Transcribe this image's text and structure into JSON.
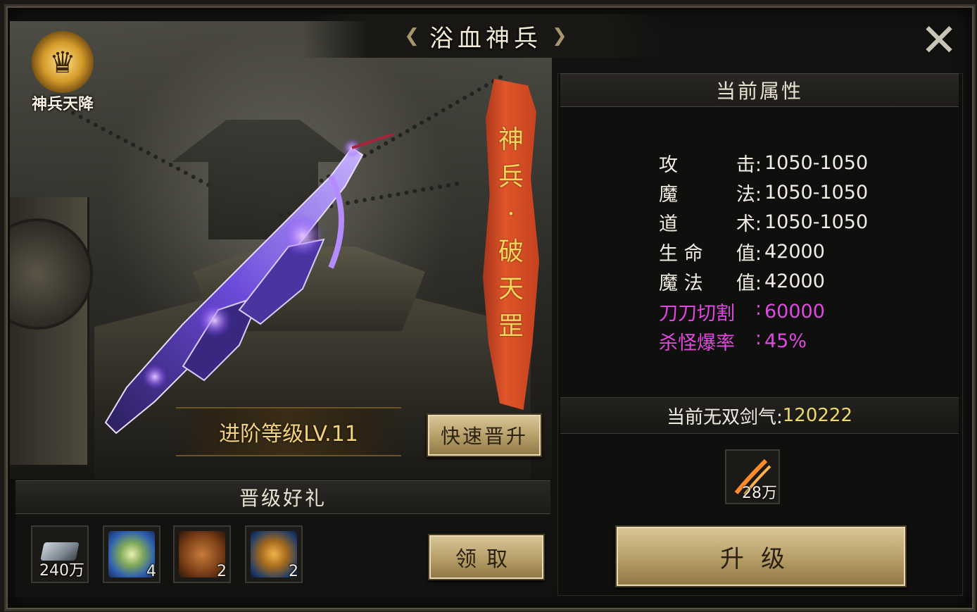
{
  "window": {
    "title": "浴血神兵",
    "close_icon": "close-x-icon"
  },
  "badge": {
    "label": "神兵天降",
    "icon": "golden-crest-icon"
  },
  "weapon": {
    "banner_chars": [
      "神",
      "兵",
      "·",
      "破",
      "天",
      "罡"
    ]
  },
  "level": {
    "text": "进阶等级LV.11"
  },
  "buttons": {
    "quick_upgrade": "快速晋升",
    "claim": "领取",
    "upgrade": "升级"
  },
  "gifts": {
    "header": "晋级好礼",
    "items": [
      {
        "icon": "silver-ingot-icon",
        "qty": "240万"
      },
      {
        "icon": "jade-orb-icon",
        "qty": "4"
      },
      {
        "icon": "scroll-icon",
        "qty": "2"
      },
      {
        "icon": "gold-scroll-icon",
        "qty": "2"
      }
    ]
  },
  "attributes": {
    "header": "当前属性",
    "rows": [
      {
        "label": [
          "攻",
          "击:"
        ],
        "value": "1050-1050",
        "special": false
      },
      {
        "label": [
          "魔",
          "法:"
        ],
        "value": "1050-1050",
        "special": false
      },
      {
        "label": [
          "道",
          "术:"
        ],
        "value": "1050-1050",
        "special": false
      },
      {
        "label": [
          "生 命",
          "值:"
        ],
        "value": "42000",
        "special": false
      },
      {
        "label": [
          "魔 法",
          "值:"
        ],
        "value": "42000",
        "special": false
      },
      {
        "label": [
          "刀刀切割",
          ":"
        ],
        "value": "60000",
        "special": true
      },
      {
        "label": [
          "杀怪爆率",
          ":"
        ],
        "value": "45%",
        "special": true
      }
    ]
  },
  "sword_qi": {
    "label": "当前无双剑气:",
    "value": "120222"
  },
  "cost": {
    "icon": "sword-qi-feather-icon",
    "qty": "28万"
  },
  "colors": {
    "gold_text": "#f2d27a",
    "special_attr": "#e048e0",
    "sword_qi_value": "#ecd96a",
    "banner_red": "#d64a24"
  }
}
